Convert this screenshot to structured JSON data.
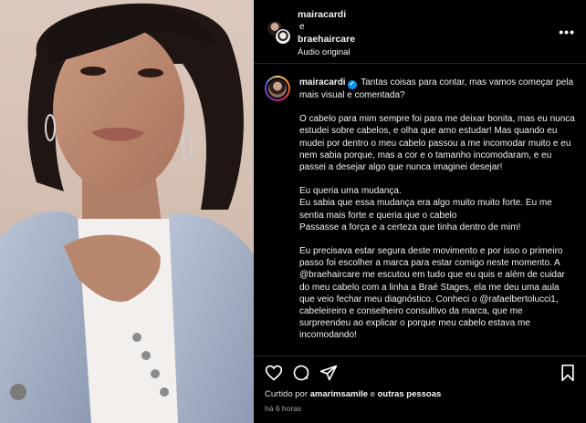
{
  "header": {
    "user1": "mairacardi",
    "conj": "e",
    "user2": "braehaircare",
    "audio": "Áudio original",
    "more_icon": "more-horizontal-icon"
  },
  "caption": {
    "username": "mairacardi",
    "verified": "✓",
    "intro": "Tantas coisas para contar, mas vamos começar pela mais visual e comentada?",
    "p1": "O cabelo para mim sempre foi para me deixar bonita, mas eu nunca estudei sobre cabelos, e olha que amo estudar! Mas quando eu mudei por dentro o meu cabelo passou a me incomodar muito e eu nem sabia porque, mas a cor e o tamanho incomodaram, e eu passei a desejar algo que nunca imaginei desejar!",
    "p2_l1": "Eu queria uma mudança.",
    "p2_l2": "Eu sabia que essa mudança era algo muito muito forte. Eu me sentia mais forte e queria que o cabelo",
    "p2_l3": "Passasse a força e a certeza que tinha dentro de mim!",
    "p3": "Eu precisava estar segura deste movimento e por isso o primeiro passo foi escolher a marca para estar comigo neste momento. A @braehaircare me escutou em tudo que eu quis e além de cuidar do meu cabelo com a linha a Braé Stages, ela me deu uma aula que veio fechar meu diagnóstico. Conheci o @rafaelbertolucci1, cabeleireiro e conselheiro consultivo da marca, que me surpreendeu ao explicar o porque meu cabelo estava me incomodando!"
  },
  "footer": {
    "liked_prefix": "Curtido por",
    "liked_user": "amarimsamile",
    "liked_sep": "e",
    "liked_others": "outras pessoas",
    "time": "há 6 horas"
  },
  "colors": {
    "background": "#000000",
    "verified": "#0095f6",
    "divider": "#262626"
  }
}
